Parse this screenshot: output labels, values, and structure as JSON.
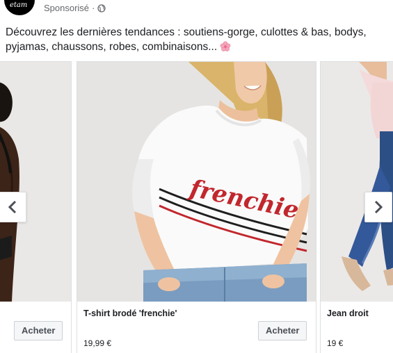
{
  "brand": {
    "logo_text": "etam"
  },
  "post": {
    "sponsored_label": "Sponsorisé",
    "separator": "·",
    "text": "Découvrez les dernières tendances : soutiens-gorge, culottes & bas, bodys, pyjamas, chaussons, robes, combinaisons...",
    "globe_icon": "globe-icon",
    "flower_icon": "cherry-blossom-emoji"
  },
  "carousel": {
    "cards": [
      {
        "title": "",
        "price": "",
        "cta": "Acheter",
        "image": "model-dark-top"
      },
      {
        "title": "T-shirt brodé 'frenchie'",
        "price": "19,99 €",
        "cta": "Acheter",
        "image": "model-white-tshirt-frenchie",
        "print_text": "frenchie"
      },
      {
        "title": "Jean droit",
        "price": "19 €",
        "cta": "",
        "image": "model-blue-jeans"
      }
    ],
    "prev_icon": "chevron-left-icon",
    "next_icon": "chevron-right-icon"
  },
  "colors": {
    "text": "#1c1e21",
    "muted": "#65676b",
    "button_bg": "#f5f6f7",
    "button_text": "#4b4f56",
    "border": "#dddfe2",
    "print_red": "#c1272d"
  }
}
